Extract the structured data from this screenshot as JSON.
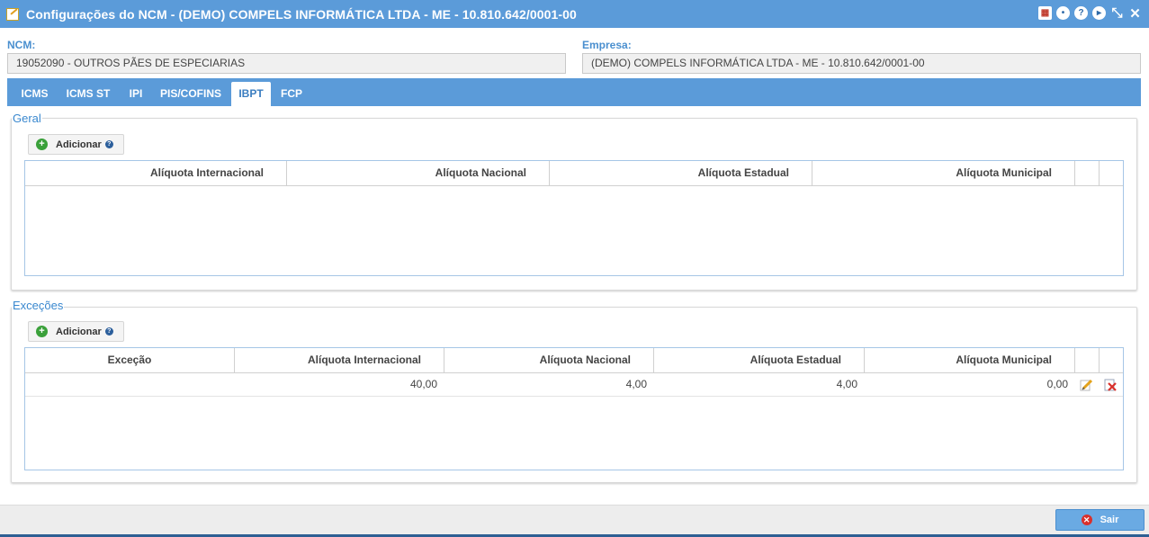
{
  "window": {
    "title": "Configurações do NCM - (DEMO) COMPELS INFORMÁTICA LTDA - ME - 10.810.642/0001-00",
    "icons": [
      "calendar-icon",
      "chat-icon",
      "help-icon",
      "play-icon",
      "collapse-icon",
      "close-icon"
    ]
  },
  "ncm": {
    "label": "NCM:",
    "value": "19052090 - OUTROS PÃES DE ESPECIARIAS"
  },
  "empresa": {
    "label": "Empresa:",
    "value": "(DEMO) COMPELS INFORMÁTICA LTDA - ME - 10.810.642/0001-00"
  },
  "tabs": [
    {
      "label": "ICMS",
      "active": false
    },
    {
      "label": "ICMS ST",
      "active": false
    },
    {
      "label": "IPI",
      "active": false
    },
    {
      "label": "PIS/COFINS",
      "active": false
    },
    {
      "label": "IBPT",
      "active": true
    },
    {
      "label": "FCP",
      "active": false
    }
  ],
  "geral": {
    "legend": "Geral",
    "add_label": "Adicionar",
    "columns": [
      "Alíquota Internacional",
      "Alíquota Nacional",
      "Alíquota Estadual",
      "Alíquota Municipal"
    ],
    "rows": []
  },
  "excecoes": {
    "legend": "Exceções",
    "add_label": "Adicionar",
    "columns": [
      "Exceção",
      "Alíquota Internacional",
      "Alíquota Nacional",
      "Alíquota Estadual",
      "Alíquota Municipal"
    ],
    "rows": [
      {
        "excecao": "",
        "internacional": "40,00",
        "nacional": "4,00",
        "estadual": "4,00",
        "municipal": "0,00"
      }
    ]
  },
  "footer": {
    "sair_label": "Sair"
  },
  "colors": {
    "accent": "#5b9bd9",
    "legend": "#3a88cf",
    "label": "#4a8fcf"
  }
}
